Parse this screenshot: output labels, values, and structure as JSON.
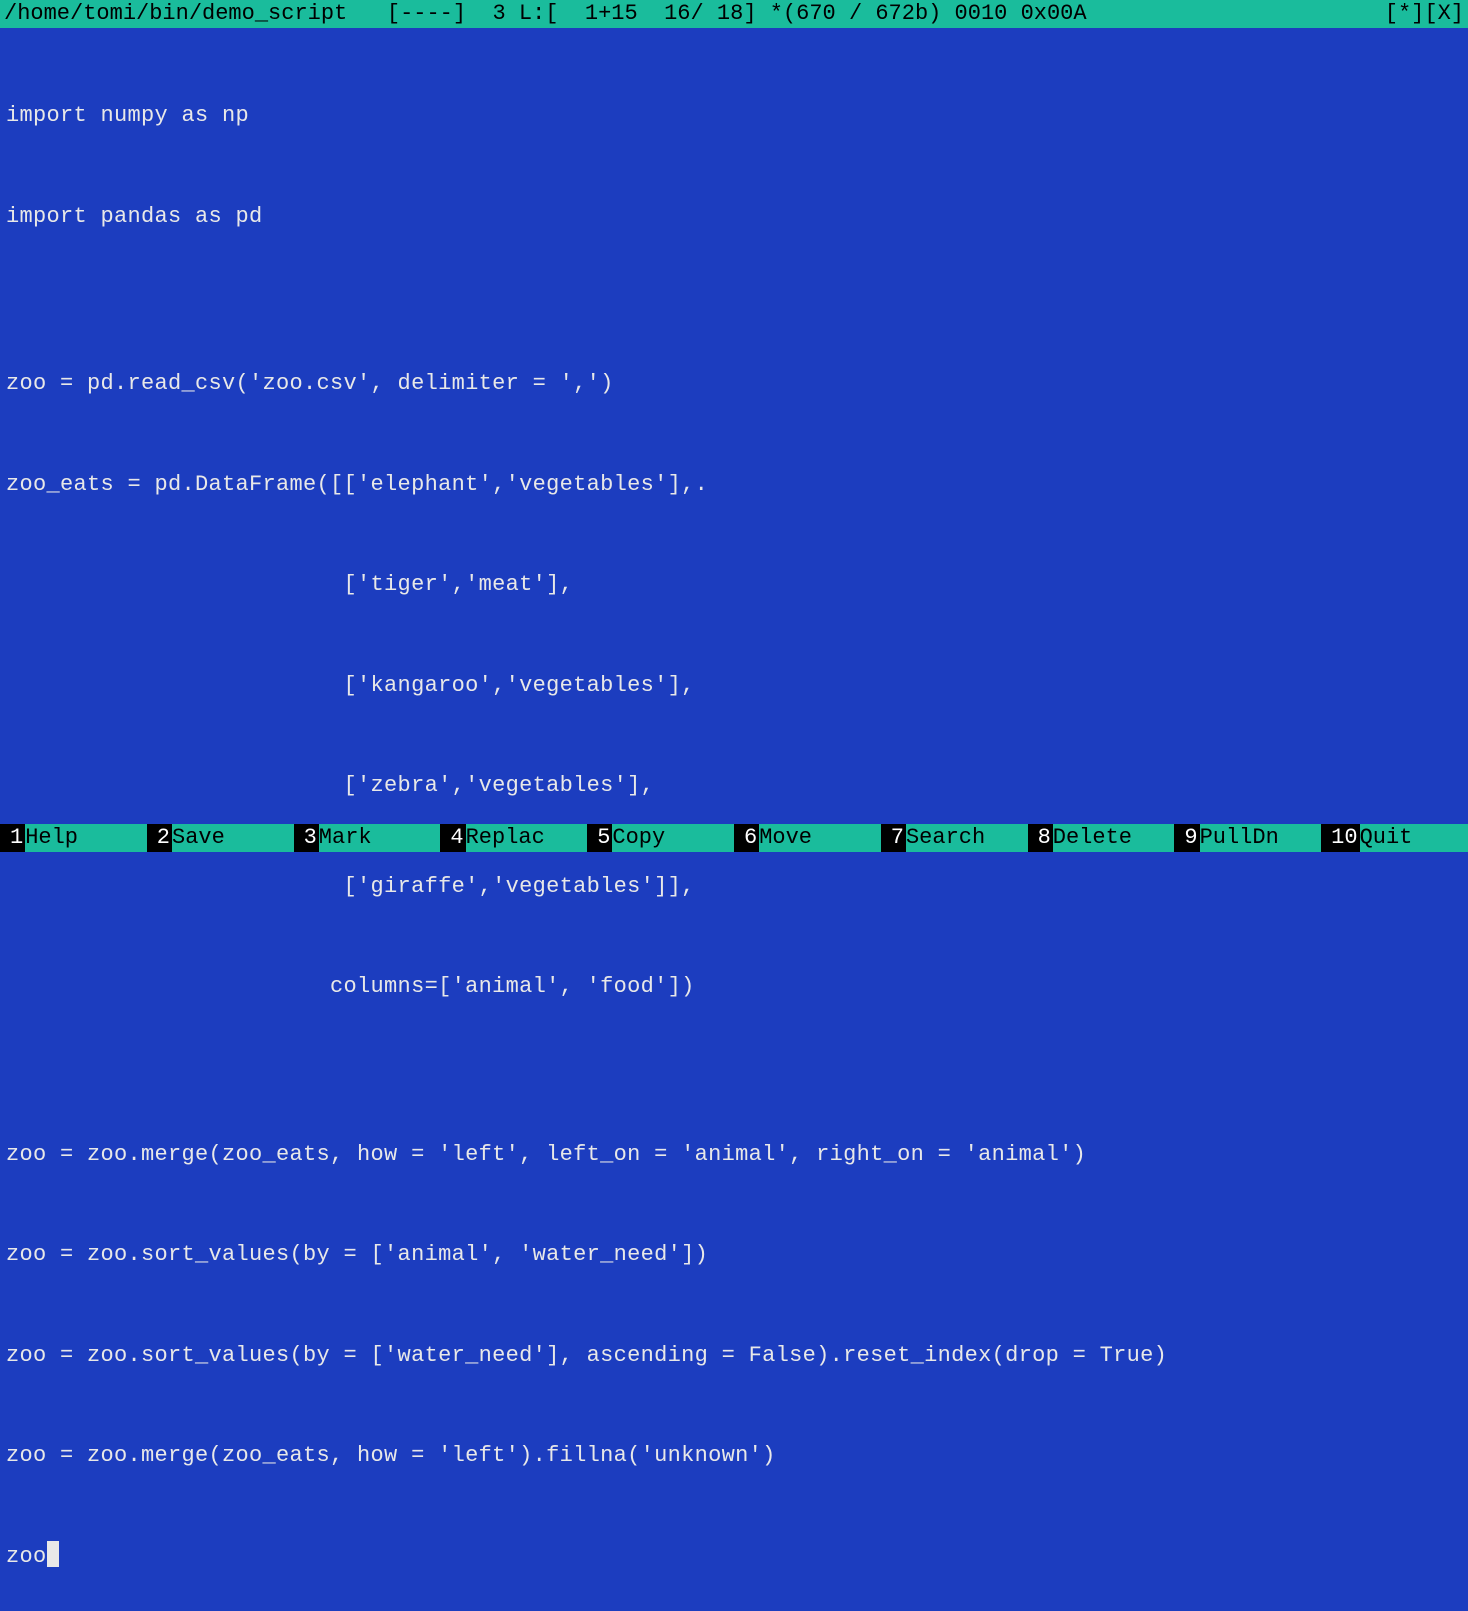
{
  "status": {
    "left": "/home/tomi/bin/demo_script   [----]  3 L:[  1+15  16/ 18] *(670 / 672b) 0010 0x00A",
    "right": "[*][X]"
  },
  "code_lines": [
    "import numpy as np",
    "import pandas as pd",
    "",
    "zoo = pd.read_csv('zoo.csv', delimiter = ',')",
    "zoo_eats = pd.DataFrame([['elephant','vegetables'],.",
    "                         ['tiger','meat'],",
    "                         ['kangaroo','vegetables'],",
    "                         ['zebra','vegetables'],",
    "                         ['giraffe','vegetables']],",
    "                        columns=['animal', 'food'])",
    "",
    "zoo = zoo.merge(zoo_eats, how = 'left', left_on = 'animal', right_on = 'animal')",
    "zoo = zoo.sort_values(by = ['animal', 'water_need'])",
    "zoo = zoo.sort_values(by = ['water_need'], ascending = False).reset_index(drop = True)",
    "zoo = zoo.merge(zoo_eats, how = 'left').fillna('unknown')"
  ],
  "cursor_line": "zoo",
  "fkeys": [
    {
      "num": "1",
      "label": "Help"
    },
    {
      "num": "2",
      "label": "Save"
    },
    {
      "num": "3",
      "label": "Mark"
    },
    {
      "num": "4",
      "label": "Replac"
    },
    {
      "num": "5",
      "label": "Copy"
    },
    {
      "num": "6",
      "label": "Move"
    },
    {
      "num": "7",
      "label": "Search"
    },
    {
      "num": "8",
      "label": "Delete"
    },
    {
      "num": "9",
      "label": "PullDn"
    },
    {
      "num": "10",
      "label": "Quit"
    }
  ]
}
